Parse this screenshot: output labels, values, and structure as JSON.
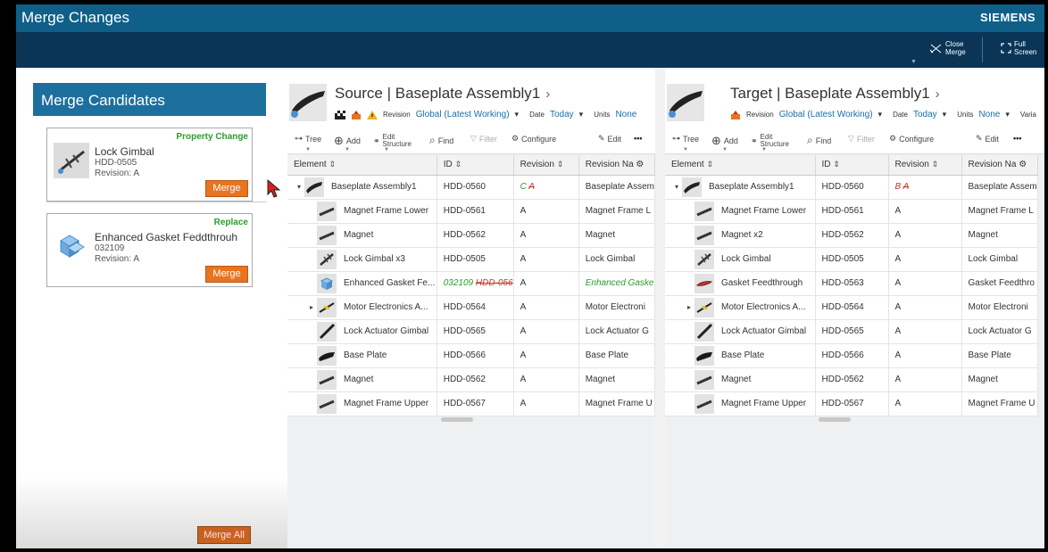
{
  "window": {
    "title": "Merge Changes",
    "brand": "SIEMENS"
  },
  "actions": {
    "close_merge": "Close Merge",
    "full_screen": "Full Screen"
  },
  "candidates": {
    "header": "Merge Candidates",
    "cards": [
      {
        "type": "Property Change",
        "name": "Lock Gimbal",
        "id": "HDD-0505",
        "revision": "Revision:  A",
        "button": "Merge"
      },
      {
        "type": "Replace",
        "name": "Enhanced Gasket Feddthrouh",
        "id": "032109",
        "revision": "Revision:  A",
        "button": "Merge"
      }
    ],
    "merge_all": "Merge All"
  },
  "source": {
    "title": "Source | Baseplate Assembly1",
    "revision_label": "Revision",
    "revision_value": "Global (Latest Working)",
    "date_label": "Date",
    "date_value": "Today",
    "units_label": "Units",
    "units_value": "None"
  },
  "target": {
    "title": "Target | Baseplate Assembly1",
    "revision_label": "Revision",
    "revision_value": "Global (Latest Working)",
    "date_label": "Date",
    "date_value": "Today",
    "units_label": "Units",
    "units_value": "None",
    "variant_label": "Varia"
  },
  "toolbar": {
    "tree": "Tree",
    "add": "Add",
    "edit_structure_1": "Edit",
    "edit_structure_2": "Structure",
    "find": "Find",
    "filter": "Filter",
    "configure": "Configure",
    "edit": "Edit",
    "more": "•••"
  },
  "columns": {
    "element": "Element",
    "id": "ID",
    "revision": "Revision",
    "revision_name": "Revision Na"
  },
  "source_rows": [
    {
      "element": "Baseplate Assembly1",
      "id": "HDD-0560",
      "rev_new": "C",
      "rev_old": "A",
      "name": "Baseplate Assem"
    },
    {
      "element": "Magnet Frame Lower",
      "id": "HDD-0561",
      "revision": "A",
      "name": "Magnet Frame L"
    },
    {
      "element": "Magnet",
      "id": "HDD-0562",
      "revision": "A",
      "name": "Magnet"
    },
    {
      "element": "Lock Gimbal x3",
      "id": "HDD-0505",
      "revision": "A",
      "name": "Lock Gimbal"
    },
    {
      "element": "Enhanced Gasket Fe...",
      "id_new": "032109",
      "id_old": "HDD-056",
      "revision": "A",
      "name": "Enhanced Gaske"
    },
    {
      "element": "Motor Electronics A...",
      "id": "HDD-0564",
      "revision": "A",
      "name": "Motor Electroni"
    },
    {
      "element": "Lock Actuator Gimbal",
      "id": "HDD-0565",
      "revision": "A",
      "name": "Lock Actuator G"
    },
    {
      "element": "Base Plate",
      "id": "HDD-0566",
      "revision": "A",
      "name": "Base Plate"
    },
    {
      "element": "Magnet",
      "id": "HDD-0562",
      "revision": "A",
      "name": "Magnet"
    },
    {
      "element": "Magnet Frame Upper",
      "id": "HDD-0567",
      "revision": "A",
      "name": "Magnet Frame U"
    }
  ],
  "target_rows": [
    {
      "element": "Baseplate Assembly1",
      "id": "HDD-0560",
      "rev_new": "B",
      "rev_old": "A",
      "name": "Baseplate Assem"
    },
    {
      "element": "Magnet Frame Lower",
      "id": "HDD-0561",
      "revision": "A",
      "name": "Magnet Frame L"
    },
    {
      "element": "Magnet x2",
      "id": "HDD-0562",
      "revision": "A",
      "name": "Magnet"
    },
    {
      "element": "Lock Gimbal",
      "id": "HDD-0505",
      "revision": "A",
      "name": "Lock Gimbal"
    },
    {
      "element": "Gasket Feedthrough",
      "id": "HDD-0563",
      "revision": "A",
      "name": "Gasket Feedthro"
    },
    {
      "element": "Motor Electronics A...",
      "id": "HDD-0564",
      "revision": "A",
      "name": "Motor Electroni"
    },
    {
      "element": "Lock Actuator Gimbal",
      "id": "HDD-0565",
      "revision": "A",
      "name": "Lock Actuator G"
    },
    {
      "element": "Base Plate",
      "id": "HDD-0566",
      "revision": "A",
      "name": "Base Plate"
    },
    {
      "element": "Magnet",
      "id": "HDD-0562",
      "revision": "A",
      "name": "Magnet"
    },
    {
      "element": "Magnet Frame Upper",
      "id": "HDD-0567",
      "revision": "A",
      "name": "Magnet Frame U"
    }
  ],
  "colors": {
    "title_bar": "#0f5f89",
    "action_bar": "#0a3557",
    "merge_button": "#e8741f",
    "change_green": "#2c9b2c",
    "change_red": "#c0392b",
    "link_blue": "#1a6ea8"
  }
}
